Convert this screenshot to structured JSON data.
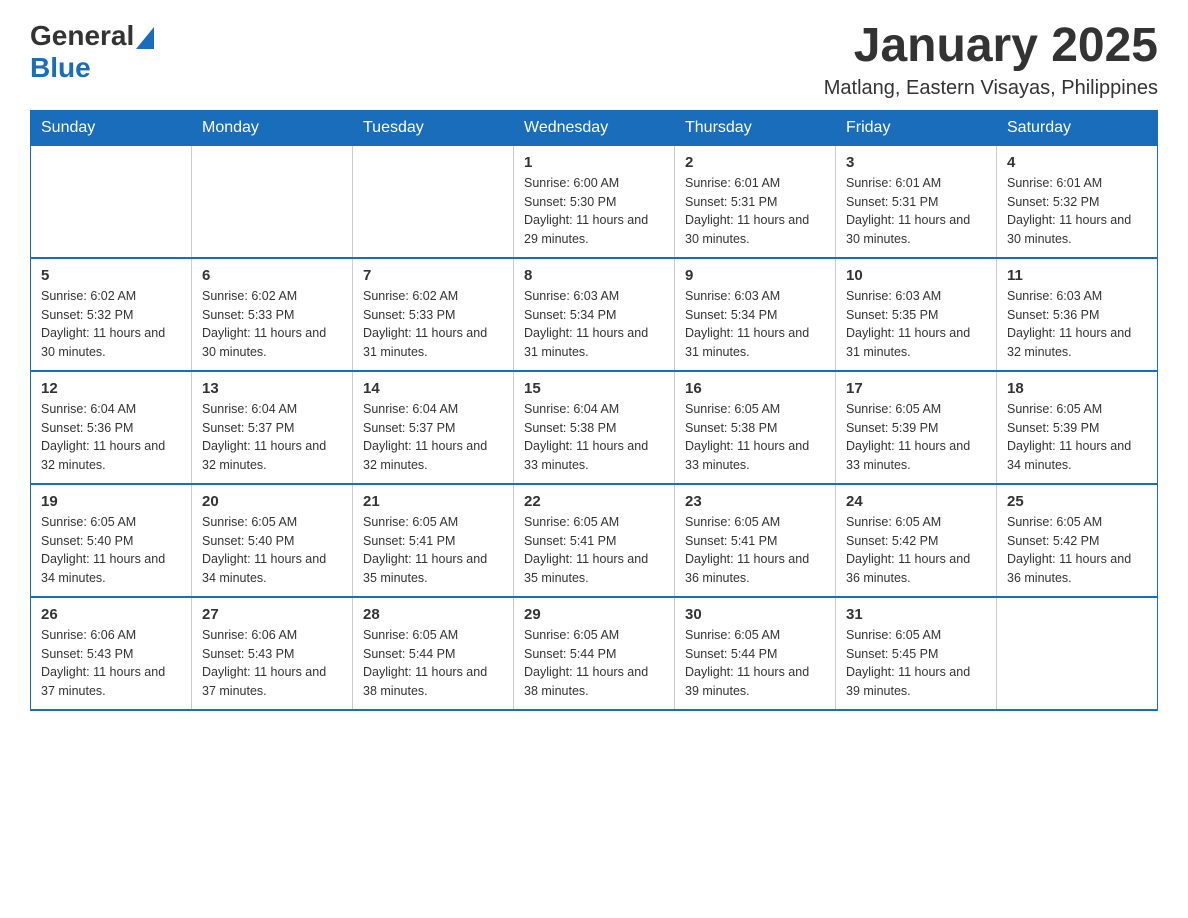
{
  "header": {
    "logo_general": "General",
    "logo_blue": "Blue",
    "title": "January 2025",
    "subtitle": "Matlang, Eastern Visayas, Philippines"
  },
  "days_of_week": [
    "Sunday",
    "Monday",
    "Tuesday",
    "Wednesday",
    "Thursday",
    "Friday",
    "Saturday"
  ],
  "weeks": [
    [
      {
        "day": "",
        "info": ""
      },
      {
        "day": "",
        "info": ""
      },
      {
        "day": "",
        "info": ""
      },
      {
        "day": "1",
        "info": "Sunrise: 6:00 AM\nSunset: 5:30 PM\nDaylight: 11 hours and 29 minutes."
      },
      {
        "day": "2",
        "info": "Sunrise: 6:01 AM\nSunset: 5:31 PM\nDaylight: 11 hours and 30 minutes."
      },
      {
        "day": "3",
        "info": "Sunrise: 6:01 AM\nSunset: 5:31 PM\nDaylight: 11 hours and 30 minutes."
      },
      {
        "day": "4",
        "info": "Sunrise: 6:01 AM\nSunset: 5:32 PM\nDaylight: 11 hours and 30 minutes."
      }
    ],
    [
      {
        "day": "5",
        "info": "Sunrise: 6:02 AM\nSunset: 5:32 PM\nDaylight: 11 hours and 30 minutes."
      },
      {
        "day": "6",
        "info": "Sunrise: 6:02 AM\nSunset: 5:33 PM\nDaylight: 11 hours and 30 minutes."
      },
      {
        "day": "7",
        "info": "Sunrise: 6:02 AM\nSunset: 5:33 PM\nDaylight: 11 hours and 31 minutes."
      },
      {
        "day": "8",
        "info": "Sunrise: 6:03 AM\nSunset: 5:34 PM\nDaylight: 11 hours and 31 minutes."
      },
      {
        "day": "9",
        "info": "Sunrise: 6:03 AM\nSunset: 5:34 PM\nDaylight: 11 hours and 31 minutes."
      },
      {
        "day": "10",
        "info": "Sunrise: 6:03 AM\nSunset: 5:35 PM\nDaylight: 11 hours and 31 minutes."
      },
      {
        "day": "11",
        "info": "Sunrise: 6:03 AM\nSunset: 5:36 PM\nDaylight: 11 hours and 32 minutes."
      }
    ],
    [
      {
        "day": "12",
        "info": "Sunrise: 6:04 AM\nSunset: 5:36 PM\nDaylight: 11 hours and 32 minutes."
      },
      {
        "day": "13",
        "info": "Sunrise: 6:04 AM\nSunset: 5:37 PM\nDaylight: 11 hours and 32 minutes."
      },
      {
        "day": "14",
        "info": "Sunrise: 6:04 AM\nSunset: 5:37 PM\nDaylight: 11 hours and 32 minutes."
      },
      {
        "day": "15",
        "info": "Sunrise: 6:04 AM\nSunset: 5:38 PM\nDaylight: 11 hours and 33 minutes."
      },
      {
        "day": "16",
        "info": "Sunrise: 6:05 AM\nSunset: 5:38 PM\nDaylight: 11 hours and 33 minutes."
      },
      {
        "day": "17",
        "info": "Sunrise: 6:05 AM\nSunset: 5:39 PM\nDaylight: 11 hours and 33 minutes."
      },
      {
        "day": "18",
        "info": "Sunrise: 6:05 AM\nSunset: 5:39 PM\nDaylight: 11 hours and 34 minutes."
      }
    ],
    [
      {
        "day": "19",
        "info": "Sunrise: 6:05 AM\nSunset: 5:40 PM\nDaylight: 11 hours and 34 minutes."
      },
      {
        "day": "20",
        "info": "Sunrise: 6:05 AM\nSunset: 5:40 PM\nDaylight: 11 hours and 34 minutes."
      },
      {
        "day": "21",
        "info": "Sunrise: 6:05 AM\nSunset: 5:41 PM\nDaylight: 11 hours and 35 minutes."
      },
      {
        "day": "22",
        "info": "Sunrise: 6:05 AM\nSunset: 5:41 PM\nDaylight: 11 hours and 35 minutes."
      },
      {
        "day": "23",
        "info": "Sunrise: 6:05 AM\nSunset: 5:41 PM\nDaylight: 11 hours and 36 minutes."
      },
      {
        "day": "24",
        "info": "Sunrise: 6:05 AM\nSunset: 5:42 PM\nDaylight: 11 hours and 36 minutes."
      },
      {
        "day": "25",
        "info": "Sunrise: 6:05 AM\nSunset: 5:42 PM\nDaylight: 11 hours and 36 minutes."
      }
    ],
    [
      {
        "day": "26",
        "info": "Sunrise: 6:06 AM\nSunset: 5:43 PM\nDaylight: 11 hours and 37 minutes."
      },
      {
        "day": "27",
        "info": "Sunrise: 6:06 AM\nSunset: 5:43 PM\nDaylight: 11 hours and 37 minutes."
      },
      {
        "day": "28",
        "info": "Sunrise: 6:05 AM\nSunset: 5:44 PM\nDaylight: 11 hours and 38 minutes."
      },
      {
        "day": "29",
        "info": "Sunrise: 6:05 AM\nSunset: 5:44 PM\nDaylight: 11 hours and 38 minutes."
      },
      {
        "day": "30",
        "info": "Sunrise: 6:05 AM\nSunset: 5:44 PM\nDaylight: 11 hours and 39 minutes."
      },
      {
        "day": "31",
        "info": "Sunrise: 6:05 AM\nSunset: 5:45 PM\nDaylight: 11 hours and 39 minutes."
      },
      {
        "day": "",
        "info": ""
      }
    ]
  ],
  "accent_color": "#1a6dbb"
}
